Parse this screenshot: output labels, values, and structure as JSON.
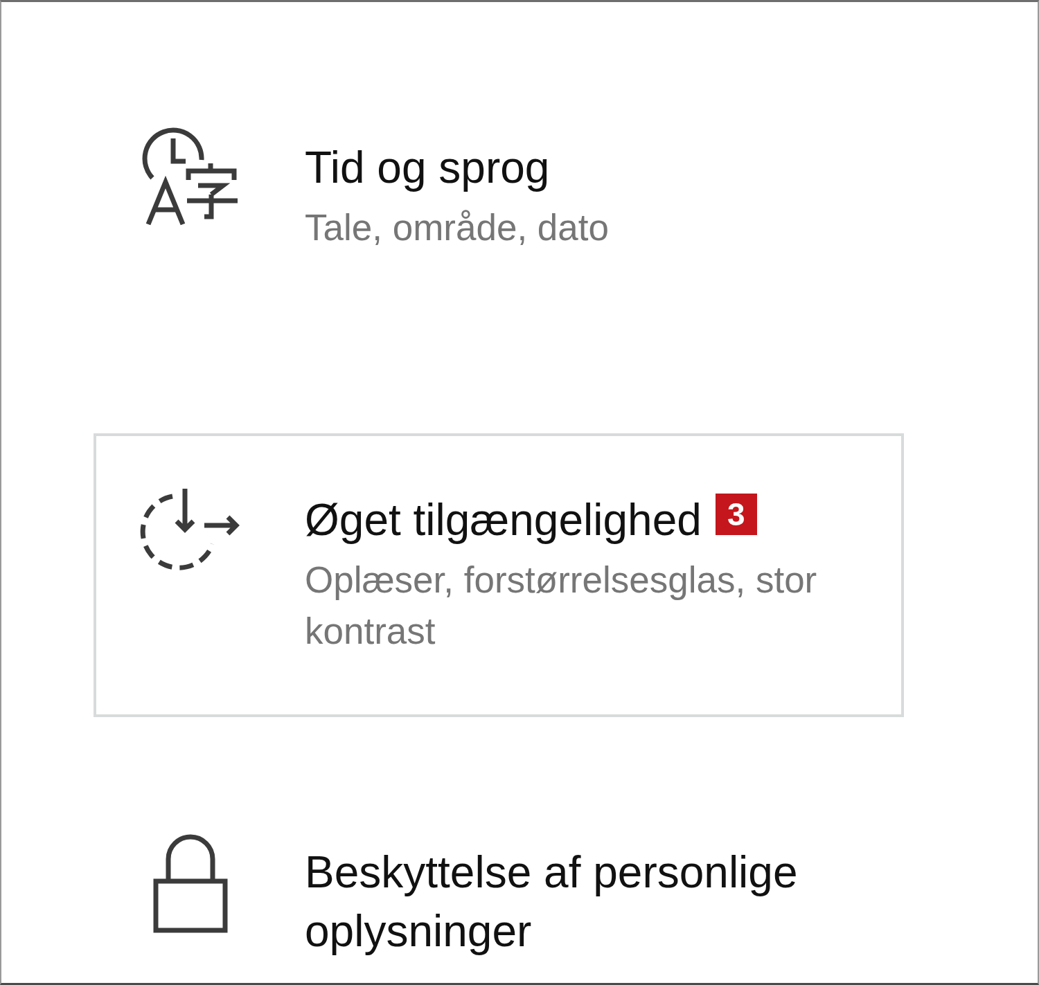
{
  "categories": [
    {
      "kind": "time-language",
      "title": "Tid og sprog",
      "description": "Tale, område, dato",
      "focused": false
    },
    {
      "kind": "accessibility",
      "title": "Øget tilgængelighed",
      "badge": "3",
      "description": "Oplæser, forstørrelsesglas, stor kontrast",
      "focused": true
    },
    {
      "kind": "privacy",
      "title": "Beskyttelse af personlige oplysninger",
      "focused": false
    }
  ]
}
